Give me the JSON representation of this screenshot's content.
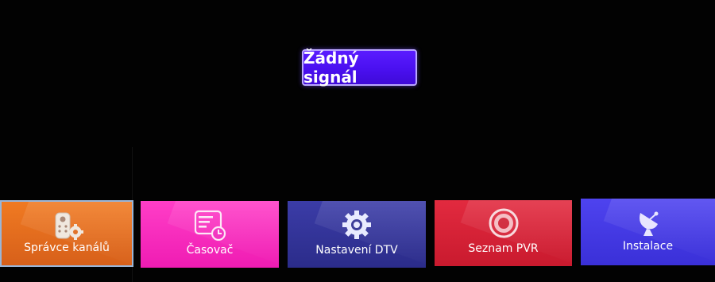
{
  "status": {
    "no_signal": "Žádný signál"
  },
  "menu": {
    "tiles": [
      {
        "label": "Správce kanálů",
        "icon": "remote-gear-icon",
        "color": "#E86E1F"
      },
      {
        "label": "Časovač",
        "icon": "schedule-clock-icon",
        "color": "#F82AC0"
      },
      {
        "label": "Nastavení DTV",
        "icon": "gear-icon",
        "color": "#34359A"
      },
      {
        "label": "Seznam PVR",
        "icon": "record-icon",
        "color": "#D82337"
      },
      {
        "label": "Instalace",
        "icon": "satellite-dish-icon",
        "color": "#4438E6"
      }
    ]
  }
}
